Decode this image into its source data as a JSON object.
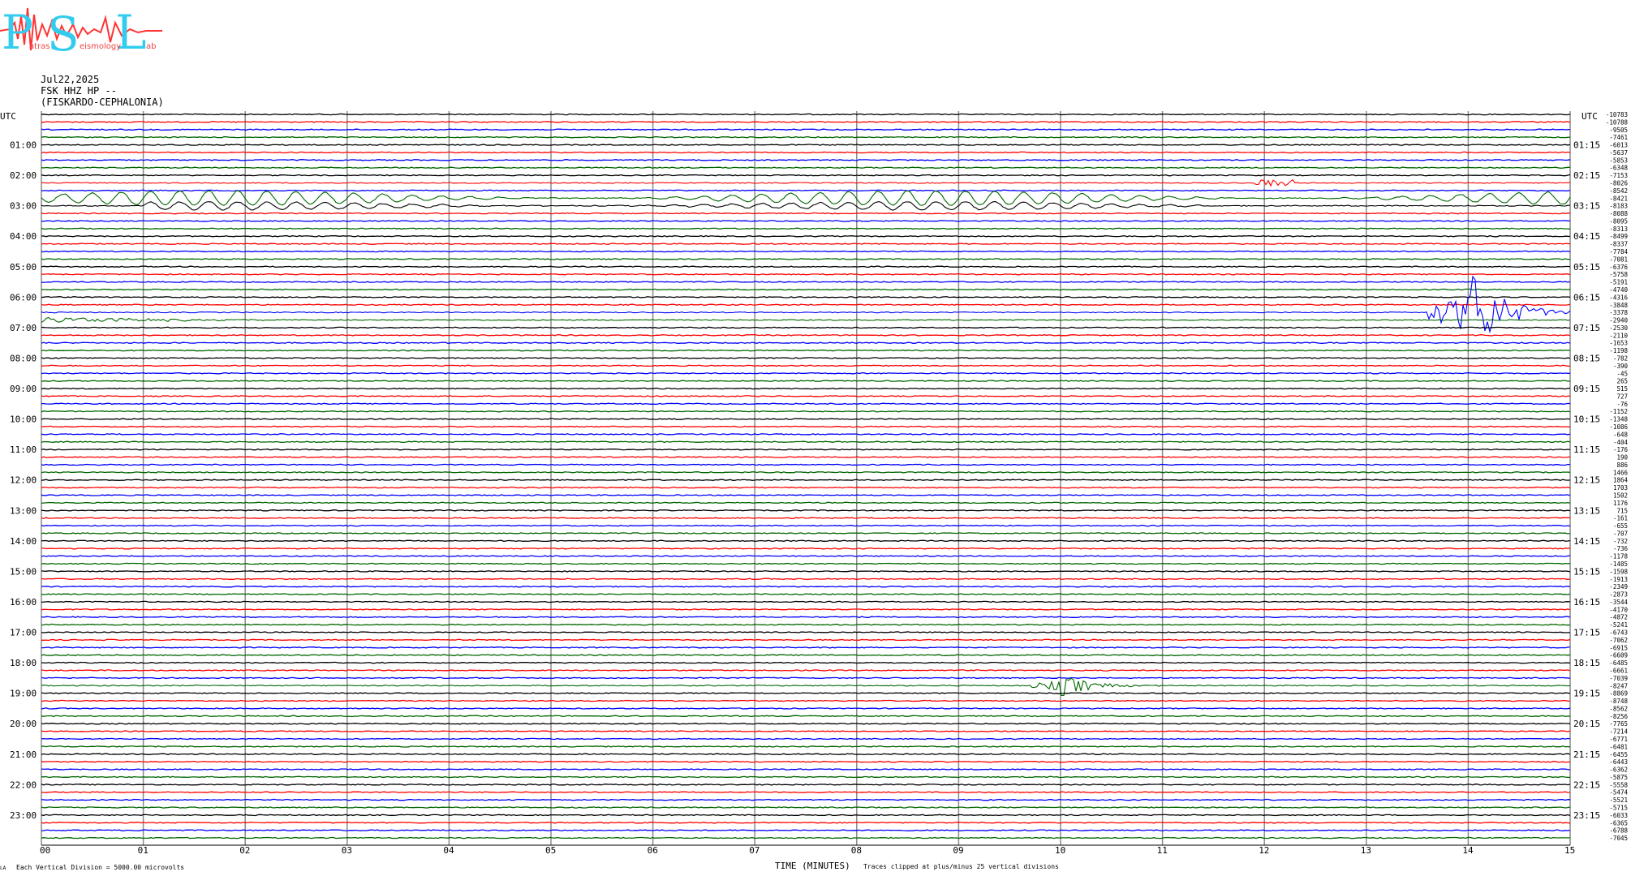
{
  "header": {
    "logo_big": [
      "P",
      "S",
      "L"
    ],
    "logo_small": [
      "atras",
      "eismology",
      "ab"
    ],
    "date": "Jul22,2025",
    "station": "FSK HHZ HP --",
    "location": "(FISKARDO-CEPHALONIA)"
  },
  "footer": {
    "scale_prefix": "LA",
    "scale_note": "Each Vertical Division = 5000.00 microvolts",
    "xlabel": "TIME (MINUTES)",
    "clip_note": "Traces clipped at plus/minus 25 vertical divisions"
  },
  "chart_data": {
    "type": "line",
    "title": "",
    "xlabel": "TIME (MINUTES)",
    "ylabel": "UTC",
    "xlim": [
      0,
      15
    ],
    "x_ticks": [
      "00",
      "01",
      "02",
      "03",
      "04",
      "05",
      "06",
      "07",
      "08",
      "09",
      "10",
      "11",
      "12",
      "13",
      "14",
      "15"
    ],
    "left_axis_title": "UTC",
    "right_axis_title": "UTC",
    "left_hour_labels": [
      "01:00",
      "02:00",
      "03:00",
      "04:00",
      "05:00",
      "06:00",
      "07:00",
      "08:00",
      "09:00",
      "10:00",
      "11:00",
      "12:00",
      "13:00",
      "14:00",
      "15:00",
      "16:00",
      "17:00",
      "18:00",
      "19:00",
      "20:00",
      "21:00",
      "22:00",
      "23:00"
    ],
    "right_hour_labels": [
      "01:15",
      "02:15",
      "03:15",
      "04:15",
      "05:15",
      "06:15",
      "07:15",
      "08:15",
      "09:15",
      "10:15",
      "11:15",
      "12:15",
      "13:15",
      "14:15",
      "15:15",
      "16:15",
      "17:15",
      "18:15",
      "19:15",
      "20:15",
      "21:15",
      "22:15",
      "23:15"
    ],
    "trace_colors": [
      "#000000",
      "#ff0000",
      "#0000ff",
      "#006600"
    ],
    "offsets": [
      "-10783",
      "-10788",
      "-9505",
      "-7461",
      "-6013",
      "-5637",
      "-5853",
      "-6348",
      "-7153",
      "-8026",
      "-8542",
      "-8421",
      "-8183",
      "-8088",
      "-8095",
      "-8313",
      "-8499",
      "-8337",
      "-7784",
      "-7081",
      "-6376",
      "-5758",
      "-5191",
      "-4740",
      "-4316",
      "-3848",
      "-3378",
      "-2940",
      "-2530",
      "-2110",
      "-1653",
      "-1198",
      "-782",
      "-390",
      "-45",
      "265",
      "515",
      "727",
      "-76",
      "-1152",
      "-1348",
      "-1086",
      "-648",
      "-404",
      "-176",
      "190",
      "886",
      "1466",
      "1864",
      "1703",
      "1502",
      "1176",
      "715",
      "-161",
      "-655",
      "-707",
      "-732",
      "-736",
      "-1178",
      "-1485",
      "-1598",
      "-1913",
      "-2349",
      "-2873",
      "-3544",
      "-4170",
      "-4872",
      "-5241",
      "-6743",
      "-7062",
      "-6915",
      "-6609",
      "-6485",
      "-6661",
      "-7039",
      "-8247",
      "-8869",
      "-8748",
      "-8562",
      "-8256",
      "-7765",
      "-7214",
      "-6771",
      "-6481",
      "-6455",
      "-6443",
      "-6362",
      "-5875",
      "-5558",
      "-5474",
      "-5521",
      "-5715",
      "-6033",
      "-6365",
      "-6788",
      "-7045"
    ],
    "events": [
      {
        "trace": 9,
        "start": 11.9,
        "end": 12.3,
        "amp": 8,
        "kind": "small"
      },
      {
        "trace": 11,
        "start": 0,
        "end": 15,
        "amp": 9,
        "kind": "swell",
        "color": "#006600"
      },
      {
        "trace": 12,
        "start": 1.0,
        "end": 11.5,
        "amp": 5,
        "kind": "swell",
        "color": "#000000"
      },
      {
        "trace": 26,
        "start": 13.6,
        "end": 15,
        "amp": 60,
        "kind": "quake",
        "peak": 14.0
      },
      {
        "trace": 27,
        "start": 0,
        "end": 3.5,
        "amp": 7,
        "kind": "decay"
      },
      {
        "trace": 75,
        "start": 9.7,
        "end": 11.2,
        "amp": 14,
        "kind": "quake",
        "peak": 10.0
      }
    ]
  }
}
